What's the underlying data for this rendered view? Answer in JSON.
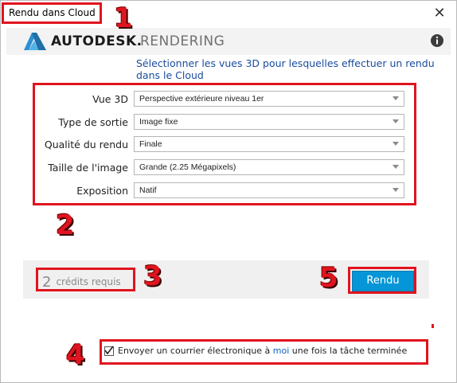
{
  "window": {
    "title": "Rendu dans Cloud",
    "close_glyph": "✕"
  },
  "header": {
    "brand": "AUTODESK.",
    "product": "RENDERING",
    "info_icon": "info-icon"
  },
  "instruction": "Sélectionner les vues 3D pour lesquelles effectuer un rendu dans le Cloud",
  "form": {
    "rows": [
      {
        "label": "Vue 3D",
        "value": "Perspective extérieure niveau 1er"
      },
      {
        "label": "Type de sortie",
        "value": "Image fixe"
      },
      {
        "label": "Qualité du rendu",
        "value": "Finale"
      },
      {
        "label": "Taille de l'image",
        "value": "Grande (2.25 Mégapixels)"
      },
      {
        "label": "Exposition",
        "value": "Natif"
      }
    ]
  },
  "footer": {
    "credits_count": "2",
    "credits_label": "crédits requis",
    "render_button": "Rendu"
  },
  "email": {
    "checked": true,
    "text_before": "Envoyer un courrier électronique à ",
    "link": "moi",
    "text_after": " une fois la tâche terminée"
  },
  "annotations": {
    "n1": "1",
    "n2": "2",
    "n3": "3",
    "n4": "4",
    "n5": "5",
    "color": "#e0141f"
  },
  "colors": {
    "accent": "#0696d7",
    "instruction_text": "#1a4b9c",
    "link": "#0b62c4"
  }
}
